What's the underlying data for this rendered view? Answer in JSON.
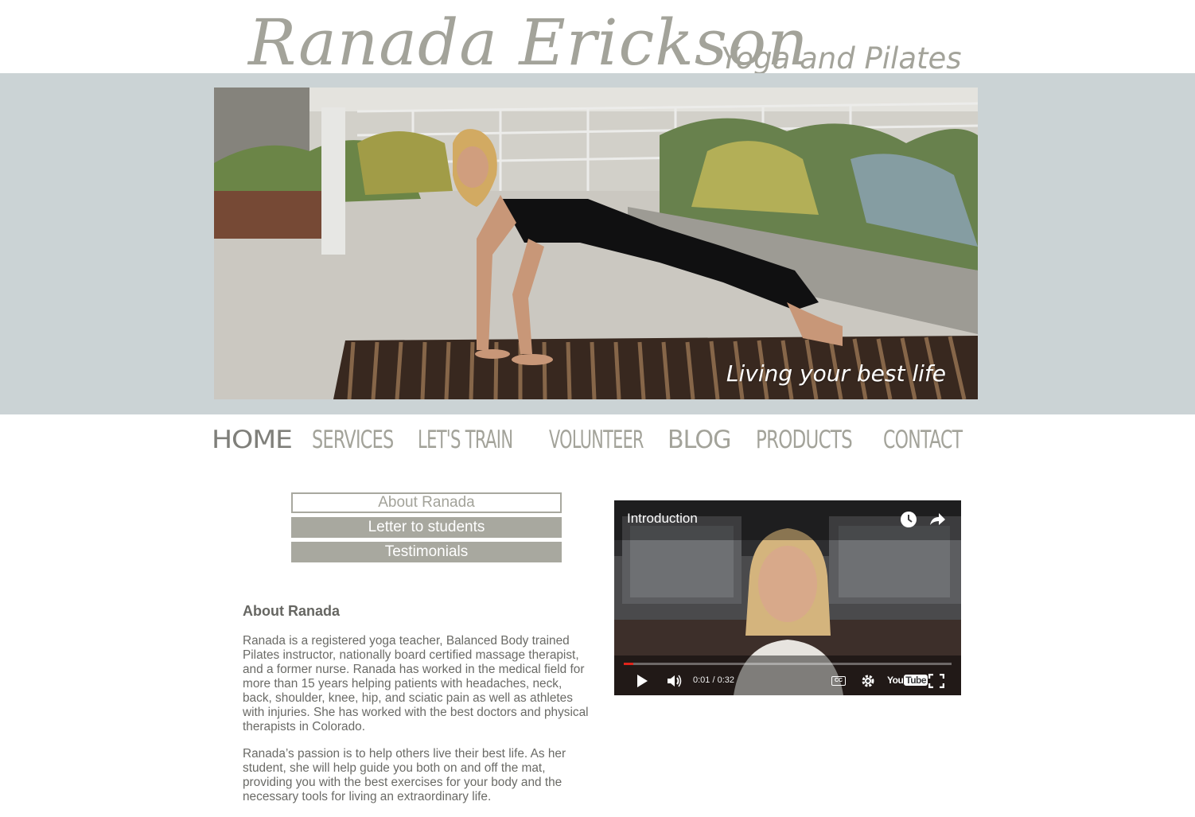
{
  "header": {
    "site_title": "Ranada Erickson",
    "tagline": "Yoga and Pilates"
  },
  "hero": {
    "caption": "Living your best life"
  },
  "nav": {
    "items": [
      {
        "label": "HOME",
        "active": true
      },
      {
        "label": "SERVICES",
        "active": false
      },
      {
        "label": "LET'S TRAIN",
        "active": false
      },
      {
        "label": "VOLUNTEER",
        "active": false
      },
      {
        "label": "BLOG",
        "active": false
      },
      {
        "label": "PRODUCTS",
        "active": false
      },
      {
        "label": "CONTACT",
        "active": false
      }
    ]
  },
  "subnav": {
    "items": [
      {
        "label": "About Ranada",
        "current": true
      },
      {
        "label": "Letter to students",
        "current": false
      },
      {
        "label": "Testimonials",
        "current": false
      }
    ]
  },
  "about": {
    "heading": "About Ranada",
    "paragraphs": [
      "Ranada is a registered yoga teacher, Balanced Body trained Pilates instructor, nationally board certified massage therapist, and a former nurse. Ranada has worked in the medical field for more than 15 years helping patients with headaches, neck, back, shoulder, knee, hip, and sciatic pain as well as athletes with injuries. She has worked with the best doctors and physical therapists in Colorado.",
      "Ranada’s passion is to help others live their best life. As her student, she will help guide you both on and off the mat, providing you with the best exercises for your body and the necessary tools for living an extraordinary life."
    ]
  },
  "video": {
    "title": "Introduction",
    "time": "0:01 / 0:32",
    "progress": 0.03,
    "cc_label": "CC",
    "logo_text": "You",
    "logo_box": "Tube",
    "icons": [
      "watch-later-icon",
      "share-icon",
      "play-icon",
      "volume-icon",
      "cc-icon",
      "settings-icon",
      "youtube-logo",
      "fullscreen-icon"
    ]
  },
  "colors": {
    "hero_band": "#cbd3d5",
    "text_gray": "#a3a39a",
    "button_gray": "#a8a89f",
    "progress_red": "#e0241b"
  }
}
